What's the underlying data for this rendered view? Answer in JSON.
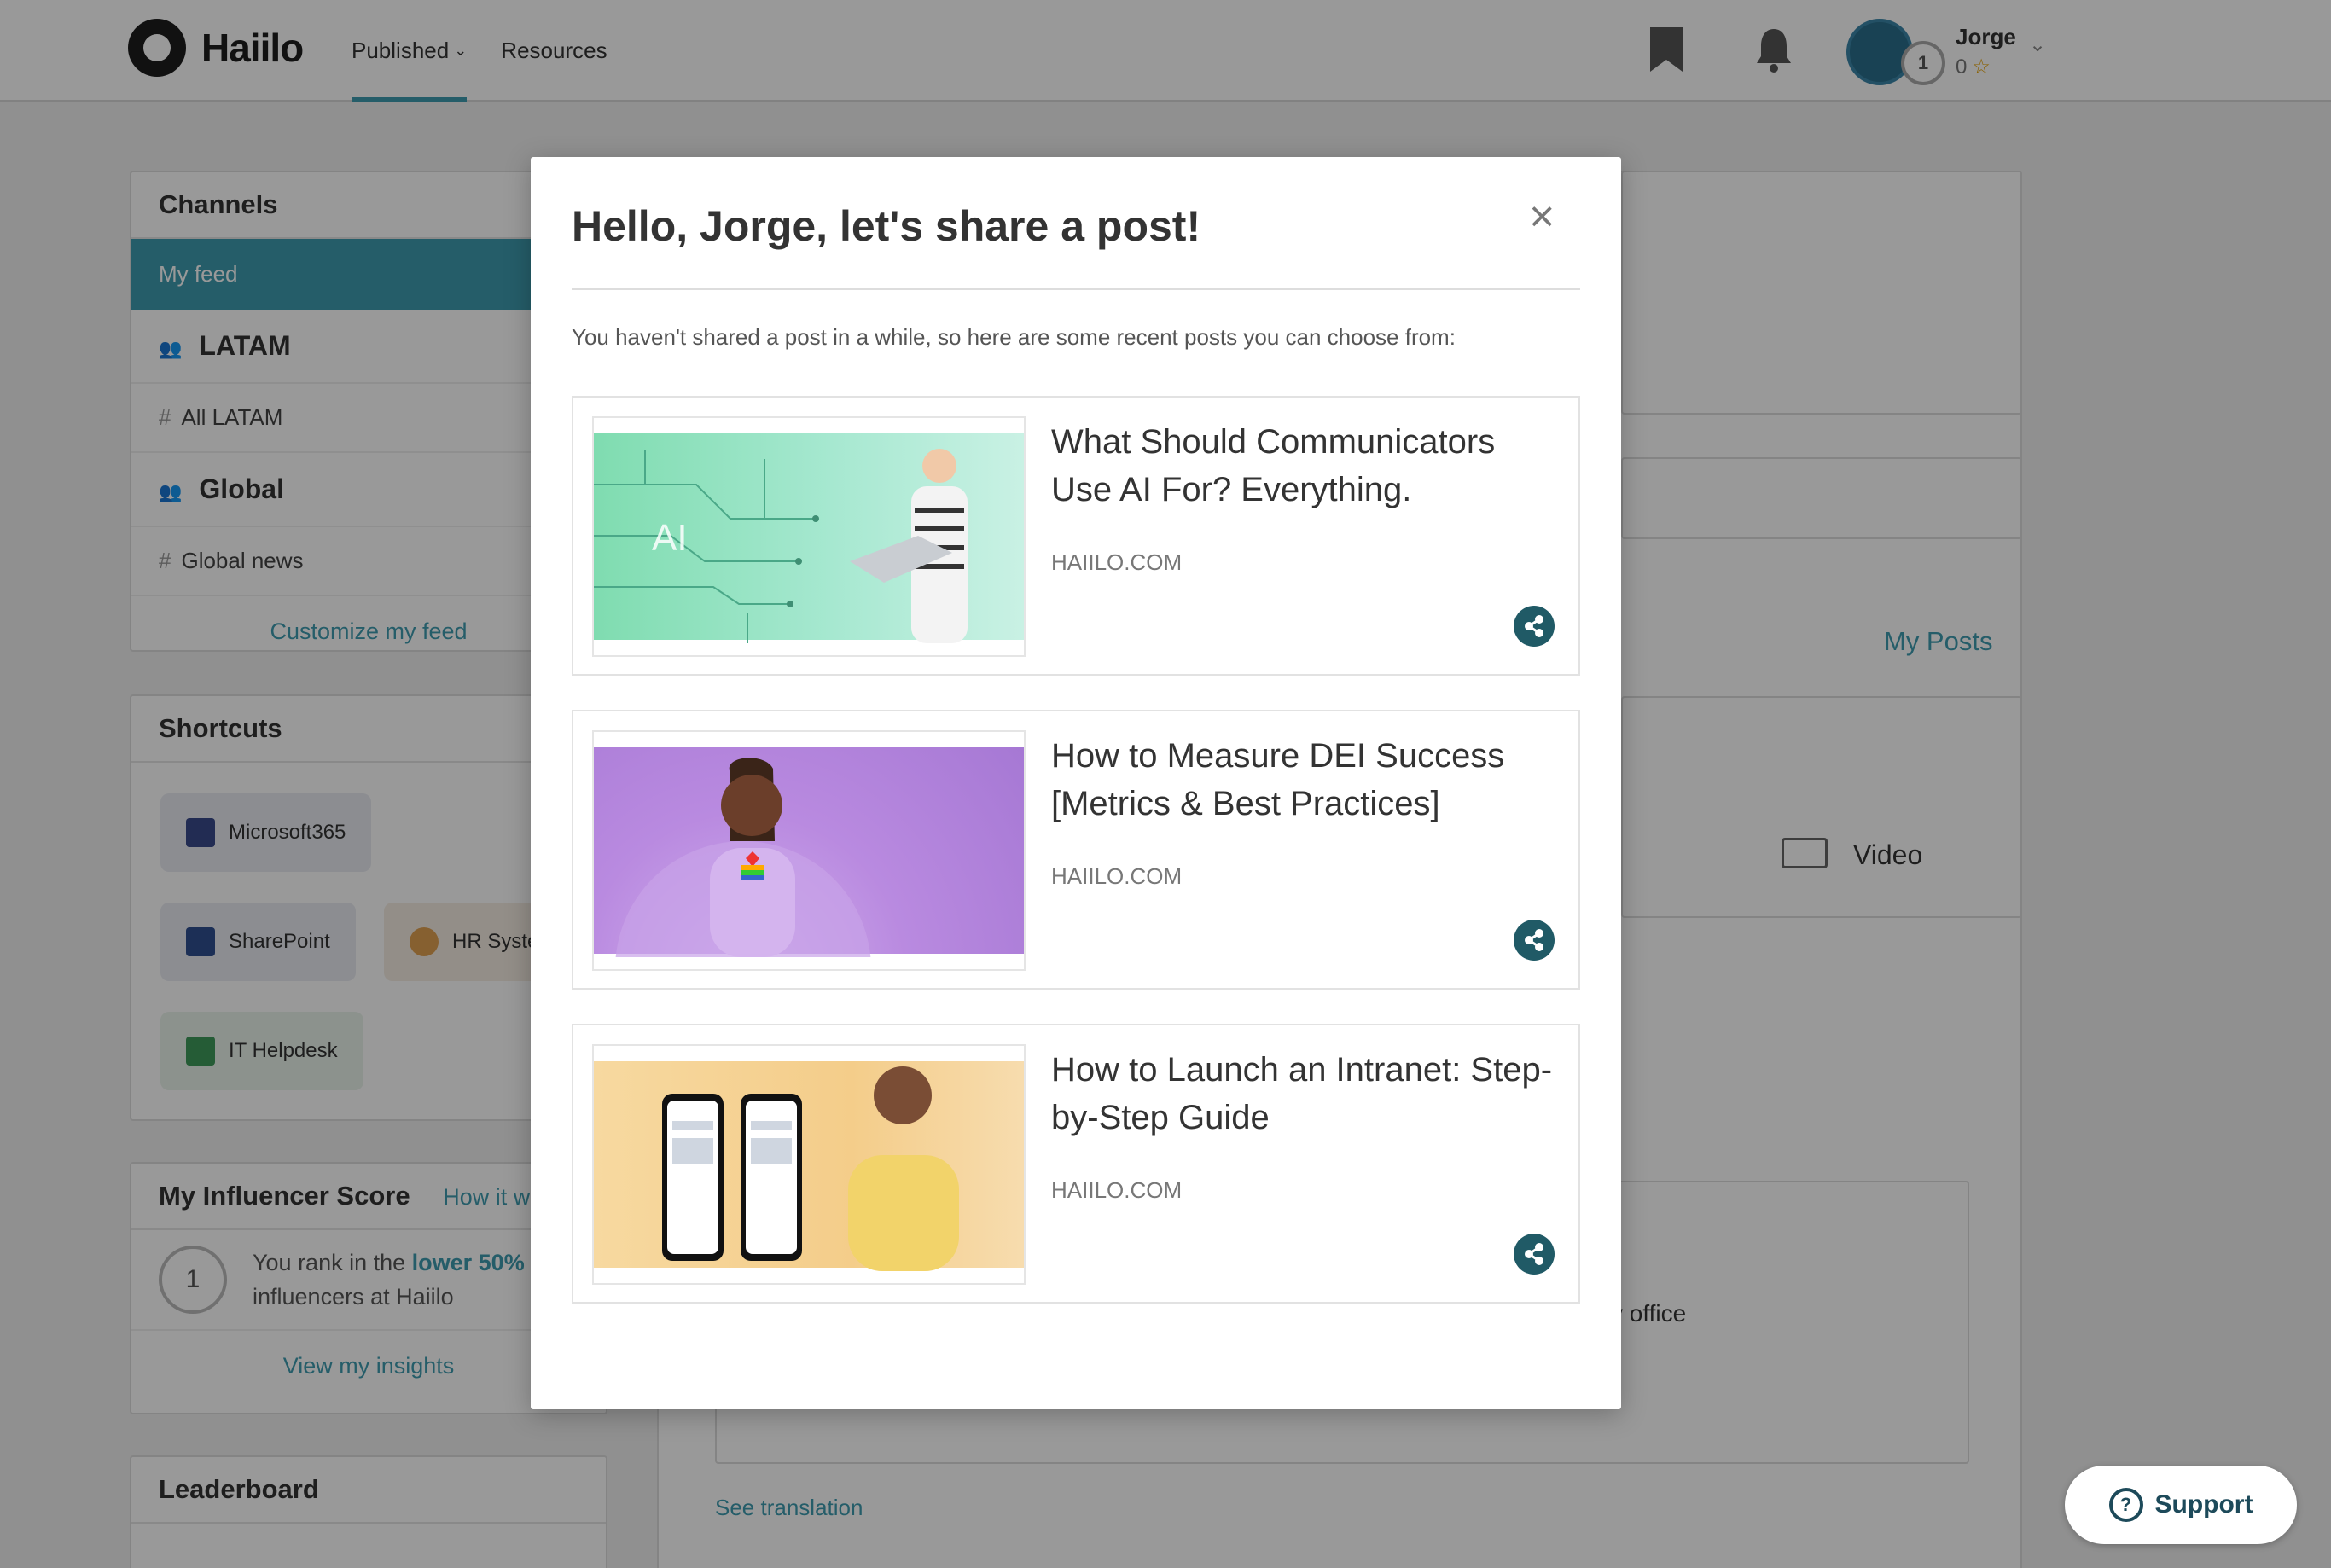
{
  "header": {
    "brand": "Haiilo",
    "nav": [
      {
        "label": "Published",
        "active": true
      },
      {
        "label": "Resources",
        "active": false
      }
    ],
    "user": {
      "name": "Jorge",
      "points": "0",
      "level": "1"
    }
  },
  "sidebar": {
    "channels": {
      "title": "Channels",
      "my_feed": "My feed",
      "groups": [
        {
          "name": "LATAM",
          "channel": "All LATAM"
        },
        {
          "name": "Global",
          "channel": "Global news"
        }
      ],
      "customize": "Customize my feed"
    },
    "shortcuts": {
      "title": "Shortcuts",
      "items": [
        "Microsoft365",
        "SharePoint",
        "HR Syste",
        "IT Helpdesk"
      ]
    },
    "influencer": {
      "title": "My Influencer Score",
      "how": "How it w",
      "score": "1",
      "rank_prefix": "You rank in the ",
      "rank_highlight": "lower 50%",
      "rank_suffix": "influencers at Haiilo",
      "insights": "View my insights"
    },
    "leaderboard": {
      "title": "Leaderboard"
    }
  },
  "main": {
    "my_posts": "My Posts",
    "video": "Video",
    "office_text": "v office",
    "see_translation": "See translation"
  },
  "support": {
    "label": "Support"
  },
  "modal": {
    "title": "Hello, Jorge, let's share a post!",
    "close": "×",
    "subtitle": "You haven't shared a post in a while, so here are some recent posts you can choose from:",
    "posts": [
      {
        "title": "What Should Communicators Use AI For? Everything.",
        "source": "HAIILO.COM",
        "thumb_text": "AI"
      },
      {
        "title": "How to Measure DEI Success [Metrics & Best Practices]",
        "source": "HAIILO.COM"
      },
      {
        "title": "How to Launch an Intranet: Step-by-Step Guide",
        "source": "HAIILO.COM"
      }
    ]
  },
  "colors": {
    "accent": "#3f9cb0",
    "share": "#205a66",
    "overlay": "rgba(0,0,0,0.40)"
  }
}
